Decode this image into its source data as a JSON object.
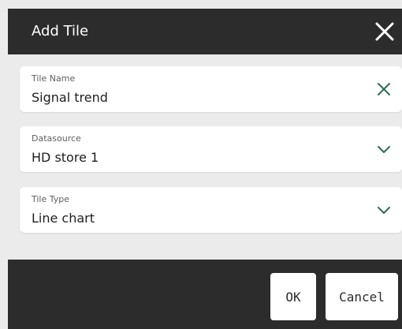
{
  "dialog": {
    "title": "Add Tile",
    "close_icon": "close-icon"
  },
  "fields": {
    "tile_name": {
      "label": "Tile Name",
      "value": "Signal trend",
      "icon": "clear-icon"
    },
    "datasource": {
      "label": "Datasource",
      "value": "HD store 1",
      "icon": "chevron-down-icon"
    },
    "tile_type": {
      "label": "Tile Type",
      "value": "Line chart",
      "icon": "chevron-down-icon"
    }
  },
  "footer": {
    "ok_label": "OK",
    "cancel_label": "Cancel"
  },
  "colors": {
    "header_bg": "#2c2c2c",
    "body_bg": "#ebebeb",
    "accent": "#2f6e58"
  }
}
